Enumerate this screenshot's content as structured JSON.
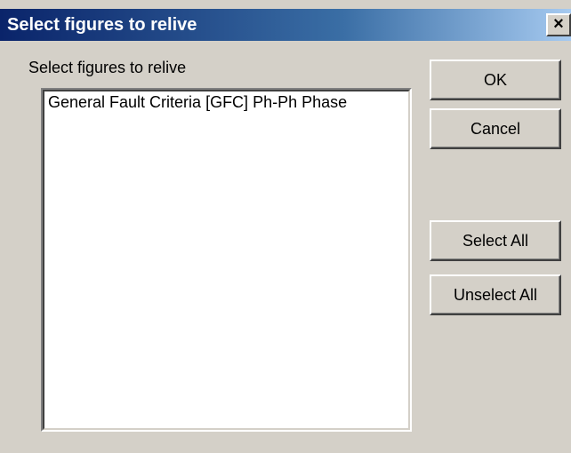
{
  "window": {
    "title": "Select figures to relive",
    "close_glyph": "×"
  },
  "list": {
    "label": "Select figures to relive",
    "items": [
      "General Fault Criteria [GFC] Ph-Ph Phase"
    ]
  },
  "buttons": {
    "ok": "OK",
    "cancel": "Cancel",
    "select_all": "Select All",
    "unselect_all": "Unselect All"
  }
}
